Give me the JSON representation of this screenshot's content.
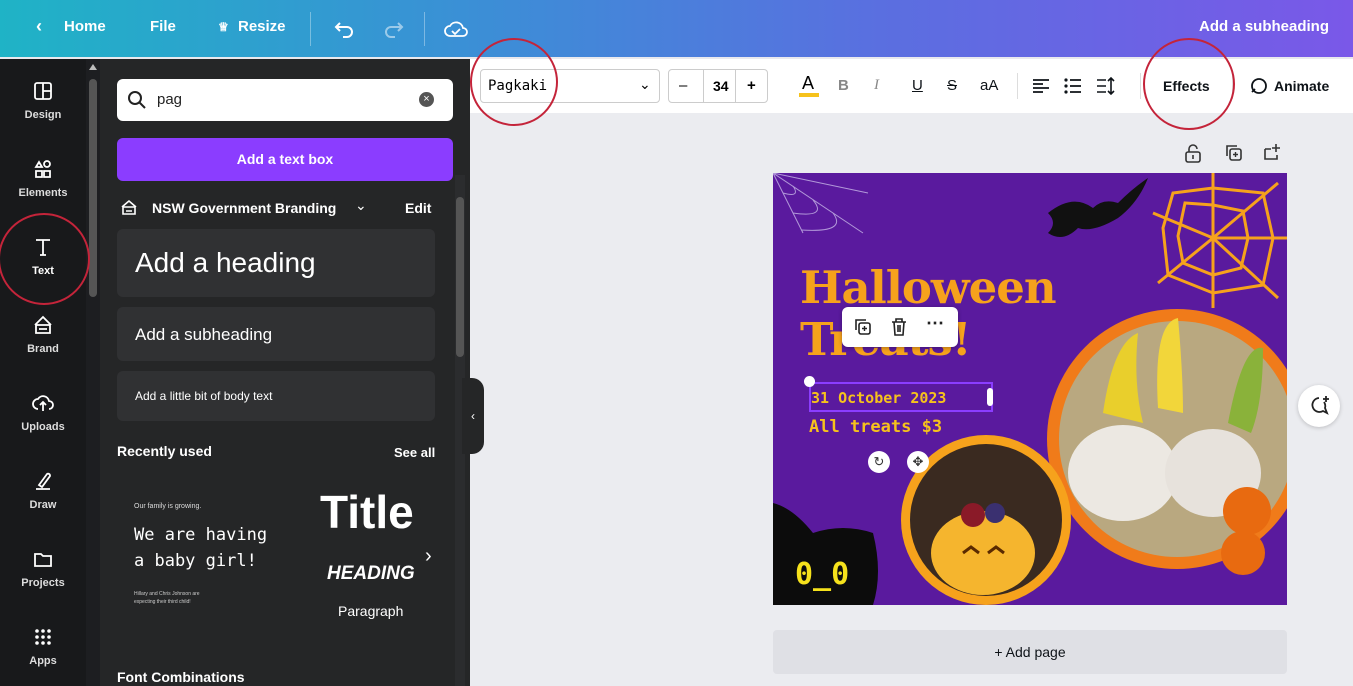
{
  "topbar": {
    "home_label": "Home",
    "file_label": "File",
    "resize_label": "Resize",
    "right_label": "Add a subheading"
  },
  "sidebar": {
    "items": [
      {
        "label": "Design",
        "icon": "layout-icon"
      },
      {
        "label": "Elements",
        "icon": "shapes-icon"
      },
      {
        "label": "Text",
        "icon": "text-icon"
      },
      {
        "label": "Brand",
        "icon": "brand-icon"
      },
      {
        "label": "Uploads",
        "icon": "cloud-upload-icon"
      },
      {
        "label": "Draw",
        "icon": "pen-icon"
      },
      {
        "label": "Projects",
        "icon": "folder-icon"
      },
      {
        "label": "Apps",
        "icon": "grid-icon"
      }
    ]
  },
  "panel": {
    "search_value": "pag",
    "add_textbox_label": "Add a text box",
    "brand_name": "NSW Government Branding",
    "edit_label": "Edit",
    "heading_label": "Add a heading",
    "subheading_label": "Add a subheading",
    "body_label": "Add a little bit of body text",
    "recently_used_label": "Recently used",
    "see_all_label": "See all",
    "sample1": {
      "small": "Our family is growing.",
      "line1": "We are having",
      "line2": "a baby girl!",
      "footer1": "Hillary and Chris Johnson are",
      "footer2": "expecting their third child!"
    },
    "sample2": {
      "title": "Title",
      "heading": "HEADING",
      "paragraph": "Paragraph"
    },
    "font_combinations_label": "Font Combinations"
  },
  "toolbar": {
    "font_name": "Pagkaki",
    "font_size": "34",
    "minus": "–",
    "plus": "+",
    "bold": "B",
    "italic": "I",
    "underline": "U",
    "strike": "S",
    "case": "aA",
    "effects_label": "Effects",
    "animate_label": "Animate"
  },
  "design": {
    "title_line1": "Halloween",
    "title_line2": "Treats!",
    "date_text": "31 October 2023",
    "price_text": "All treats $3",
    "eyes_text": "0_0"
  },
  "canvas": {
    "add_page_label": "+ Add page"
  },
  "colors": {
    "accent_purple": "#8b3dff",
    "annotation_red": "#c4243a",
    "halloween_purple": "#5a1a9e",
    "halloween_orange": "#f07b1a",
    "halloween_yellow": "#f6c21c"
  }
}
